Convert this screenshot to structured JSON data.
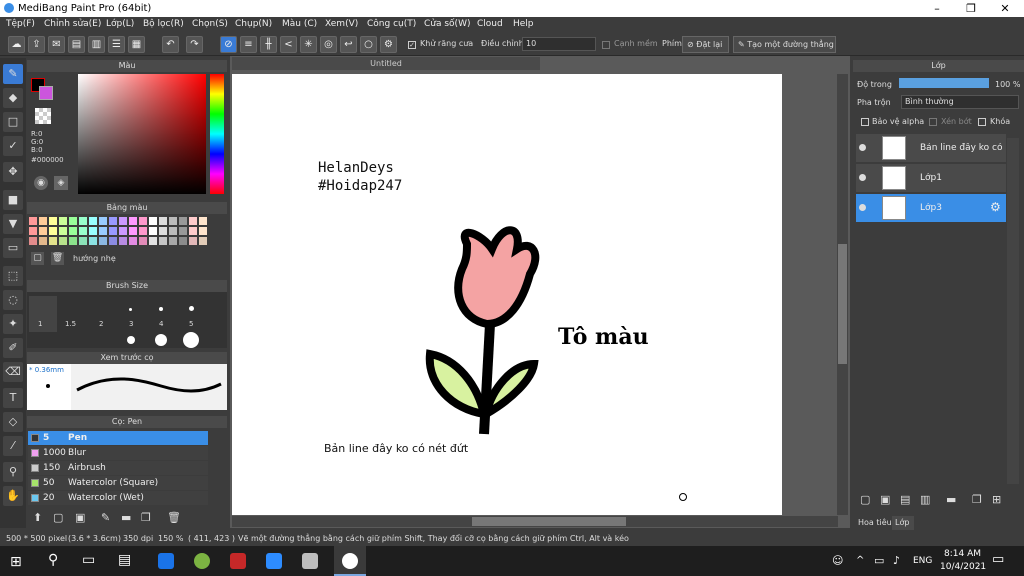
{
  "window": {
    "title": "MediBang Paint Pro (64bit)"
  },
  "menu": [
    "Tệp(F)",
    "Chỉnh sửa(E)",
    "Lớp(L)",
    "Bộ lọc(R)",
    "Chọn(S)",
    "Chụp(N)",
    "Màu (C)",
    "Xem(V)",
    "Công cụ(T)",
    "Cửa số(W)",
    "Cloud",
    "Help"
  ],
  "toolbar": {
    "antialias": "Khử răng cưa",
    "adjust": "Điều chỉnh",
    "adjust_value": "10",
    "edge": "Cạnh mềm",
    "key_label": "Phím",
    "reset": "Đặt lại",
    "straight_line": "Tạo một đường thẳng"
  },
  "color_panel": {
    "title": "Màu",
    "r": "R:0",
    "g": "G:0",
    "b": "B:0",
    "hex": "#000000"
  },
  "palette_panel": {
    "title": "Bảng màu",
    "label": "hướng nhẹ"
  },
  "brush_size_panel": {
    "title": "Brush Size",
    "sizes": [
      "1",
      "1.5",
      "2",
      "3",
      "4",
      "5"
    ]
  },
  "preview_panel": {
    "title": "Xem trước cọ",
    "size": "* 0.36mm"
  },
  "brush_panel": {
    "title": "Cọ: Pen",
    "brushes": [
      {
        "size": "5",
        "name": "Pen",
        "color": "#333333"
      },
      {
        "size": "1000",
        "name": "Blur",
        "color": "#f0a0f0"
      },
      {
        "size": "150",
        "name": "Airbrush",
        "color": "#cccccc"
      },
      {
        "size": "50",
        "name": "Watercolor (Square)",
        "color": "#a6e36b"
      },
      {
        "size": "20",
        "name": "Watercolor (Wet)",
        "color": "#6bc8f0"
      }
    ]
  },
  "canvas": {
    "tab": "Untitled",
    "text1": "HelanDeys",
    "text2": "#Hoidap247",
    "text3": "Tô màu",
    "caption": "Bản line đây ko có nét đứt"
  },
  "layer_panel": {
    "title": "Lớp",
    "opacity_label": "Độ trong",
    "opacity_value": "100 %",
    "blend_label": "Pha trộn",
    "blend_value": "Bình thường",
    "protect_alpha": "Bảo vệ alpha",
    "clip": "Xén bớt",
    "lock": "Khóa",
    "layers": [
      {
        "name": "Bản line đây ko có nét đứt"
      },
      {
        "name": "Lớp1"
      },
      {
        "name": "Lớp3"
      }
    ],
    "tab_nav": "Hoa tiêu",
    "tab_layer": "Lớp"
  },
  "status": {
    "dims": "500 * 500 pixel",
    "cm": "(3.6 * 3.6cm)",
    "dpi": "350 dpi",
    "zoom": "150 %",
    "coords": "( 411, 423 )",
    "hint": "Vẽ một đường thẳng bằng cách giữ phím Shift, Thay đổi cỡ cọ bằng cách giữ phím Ctrl, Alt và kéo"
  },
  "taskbar": {
    "lang": "ENG",
    "time": "8:14 AM",
    "date": "10/4/2021"
  }
}
